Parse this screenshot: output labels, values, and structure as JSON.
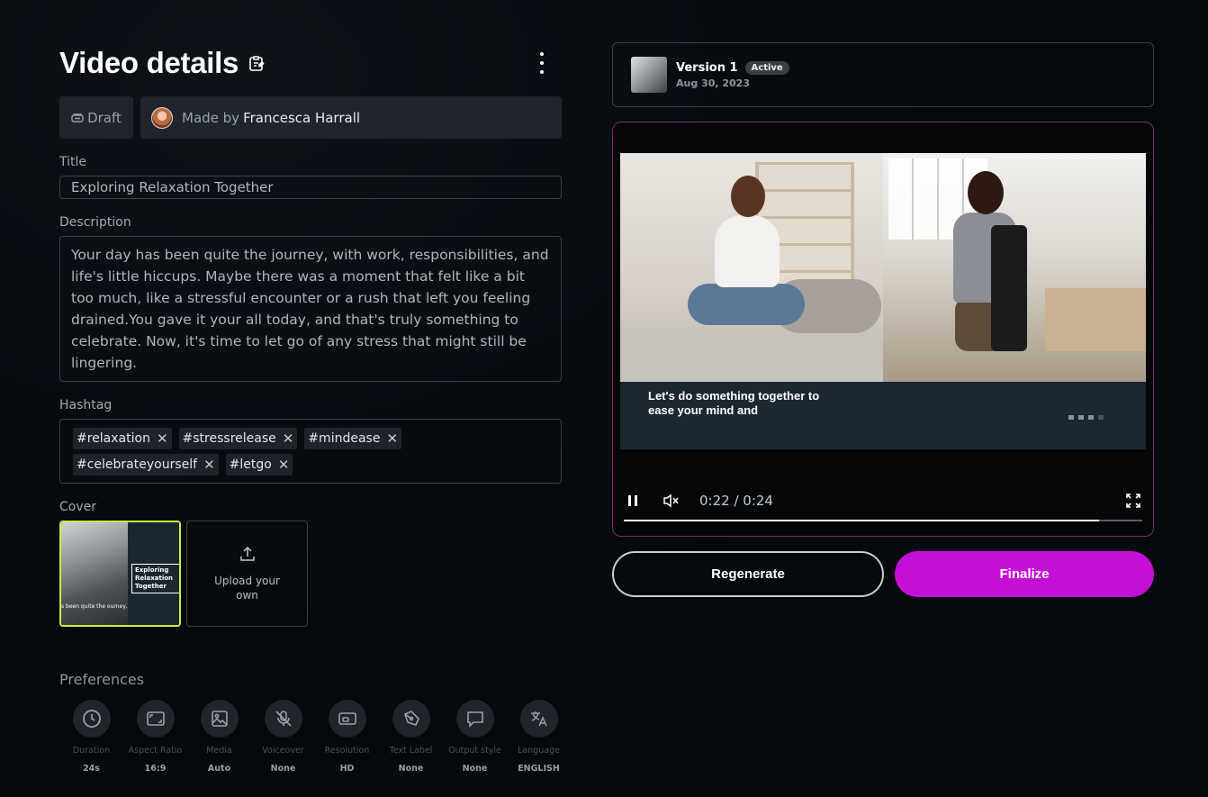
{
  "header": {
    "title": "Video details"
  },
  "meta": {
    "status": "Draft",
    "made_by_prefix": "Made by",
    "author": "Francesca Harrall"
  },
  "title_field": {
    "label": "Title",
    "value": "Exploring Relaxation Together"
  },
  "description_field": {
    "label": "Description",
    "value": "Your day has been quite the journey, with work, responsibilities, and life's little hiccups. Maybe there was a moment that felt like a bit too much, like a stressful encounter or a rush that left you feeling drained.You gave it your all today, and that's truly something to celebrate. Now, it's time to let go of any stress that might still be lingering."
  },
  "hashtag_field": {
    "label": "Hashtag",
    "tags": [
      "#relaxation",
      "#stressrelease",
      "#mindease",
      "#celebrateyourself",
      "#letgo"
    ]
  },
  "cover": {
    "label": "Cover",
    "thumb_caption": "Exploring Relaxation Together",
    "thumb_sub": "s been quite the ourney,",
    "upload_label": "Upload your own"
  },
  "preferences": {
    "title": "Preferences",
    "items": [
      {
        "label": "Duration",
        "value": "24s",
        "icon": "clock-icon"
      },
      {
        "label": "Aspect Ratio",
        "value": "16:9",
        "icon": "aspect-ratio-icon"
      },
      {
        "label": "Media",
        "value": "Auto",
        "icon": "image-icon"
      },
      {
        "label": "Voiceover",
        "value": "None",
        "icon": "mic-off-icon"
      },
      {
        "label": "Resolution",
        "value": "HD",
        "icon": "resolution-icon"
      },
      {
        "label": "Text Label",
        "value": "None",
        "icon": "pen-tool-icon"
      },
      {
        "label": "Output style",
        "value": "None",
        "icon": "speech-bubble-icon"
      },
      {
        "label": "Language",
        "value": "ENGLISH",
        "icon": "translate-icon"
      }
    ]
  },
  "version": {
    "name": "Version 1",
    "badge": "Active",
    "date": "Aug 30, 2023"
  },
  "player": {
    "caption": "Let's do something together to ease your mind and",
    "time": "0:22 / 0:24",
    "progress": 0.9167
  },
  "actions": {
    "regenerate": "Regenerate",
    "finalize": "Finalize"
  },
  "colors": {
    "accent": "#c60fd6",
    "cover_border": "#c5f23a",
    "player_border": "#7a2a74"
  }
}
